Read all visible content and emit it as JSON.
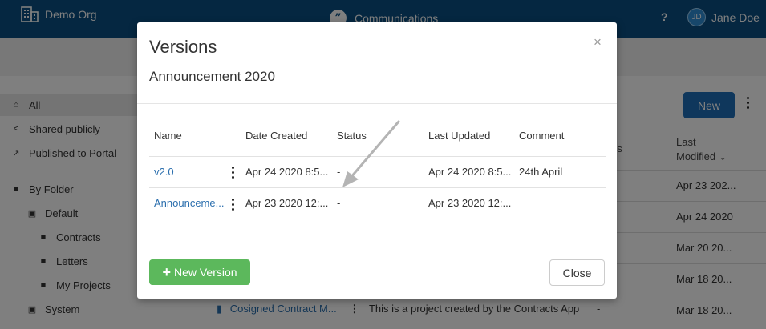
{
  "header": {
    "org_name": "Demo Org",
    "app_name": "Communications",
    "help_label": "?",
    "user_initials": "JD",
    "user_name": "Jane Doe"
  },
  "sidebar": {
    "items": [
      {
        "label": "All",
        "icon": "home-icon"
      },
      {
        "label": "Shared publicly",
        "icon": "share-icon"
      },
      {
        "label": "Published to Portal",
        "icon": "external-link-icon"
      },
      {
        "label": "By Folder",
        "icon": "folder-icon"
      },
      {
        "label": "Default",
        "icon": "briefcase-icon"
      },
      {
        "label": "Contracts",
        "icon": "folder-icon"
      },
      {
        "label": "Letters",
        "icon": "folder-icon"
      },
      {
        "label": "My Projects",
        "icon": "folder-icon"
      },
      {
        "label": "System",
        "icon": "briefcase-icon"
      }
    ]
  },
  "main": {
    "new_label": "New",
    "status_header_fragment": "us",
    "last_modified_line1": "Last",
    "last_modified_line2": "Modified",
    "rows_last_modified": [
      "Apr 23 202...",
      "Apr 24 2020",
      "Mar 20 20...",
      "Mar 18 20...",
      "Mar 18 20..."
    ],
    "bottom_row": {
      "name": "Cosigned Contract M...",
      "description": "This is a project created by the Contracts App",
      "status": "-"
    }
  },
  "modal": {
    "title": "Versions",
    "subtitle": "Announcement 2020",
    "close_symbol": "×",
    "columns": [
      "Name",
      "Date Created",
      "Status",
      "Last Updated",
      "Comment"
    ],
    "rows": [
      {
        "name": "v2.0",
        "date_created": "Apr 24 2020 8:5...",
        "status": "-",
        "last_updated": "Apr 24 2020 8:5...",
        "comment": "24th April"
      },
      {
        "name": "Announceme...",
        "date_created": "Apr 23 2020 12:...",
        "status": "-",
        "last_updated": "Apr 23 2020 12:...",
        "comment": ""
      }
    ],
    "new_version_label": "New Version",
    "close_label": "Close"
  },
  "colors": {
    "header_bg": "#0b4f82",
    "primary_button": "#1e6fb8",
    "success_button": "#5cb85c",
    "link": "#2a6ead"
  }
}
